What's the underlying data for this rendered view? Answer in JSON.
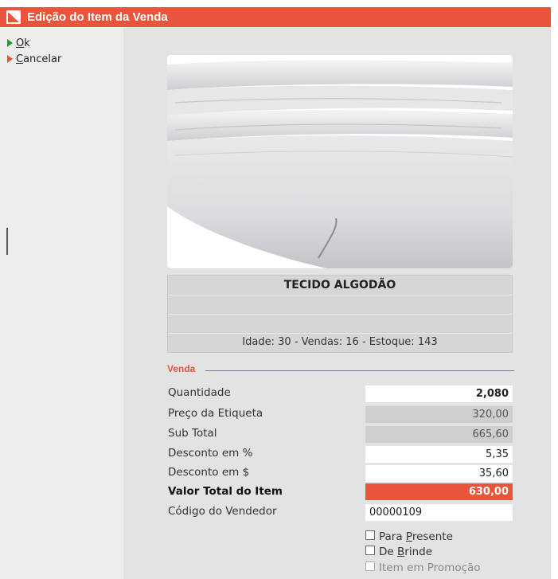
{
  "window": {
    "title": "Edição do Item da Venda",
    "accent_color": "#e8553a"
  },
  "actions": [
    {
      "label": "Ok",
      "icon": "green-arrow-icon"
    },
    {
      "label": "Cancelar",
      "icon": "orange-arrow-icon"
    }
  ],
  "product": {
    "name": "TECIDO ALGODÃO",
    "line2": "",
    "line3": "",
    "stats": "Idade: 30 - Vendas: 16 - Estoque: 143"
  },
  "venda": {
    "section_title": "Venda",
    "fields": [
      {
        "label": "Quantidade",
        "value": "2,080"
      },
      {
        "label": "Preço da Etiqueta",
        "value": "320,00"
      },
      {
        "label": "Sub Total",
        "value": "665,60"
      },
      {
        "label": "Desconto em %",
        "value": "5,35"
      },
      {
        "label": "Desconto em $",
        "value": "35,60"
      },
      {
        "label": "Valor Total do Item",
        "value": "630,00"
      },
      {
        "label": "Código do Vendedor",
        "value": "00000109"
      }
    ],
    "options": [
      {
        "label": "Para Presente",
        "checked": false,
        "enabled": true
      },
      {
        "label": "De Brinde",
        "checked": false,
        "enabled": true
      },
      {
        "label": "Item em Promoção",
        "checked": false,
        "enabled": false
      }
    ]
  }
}
